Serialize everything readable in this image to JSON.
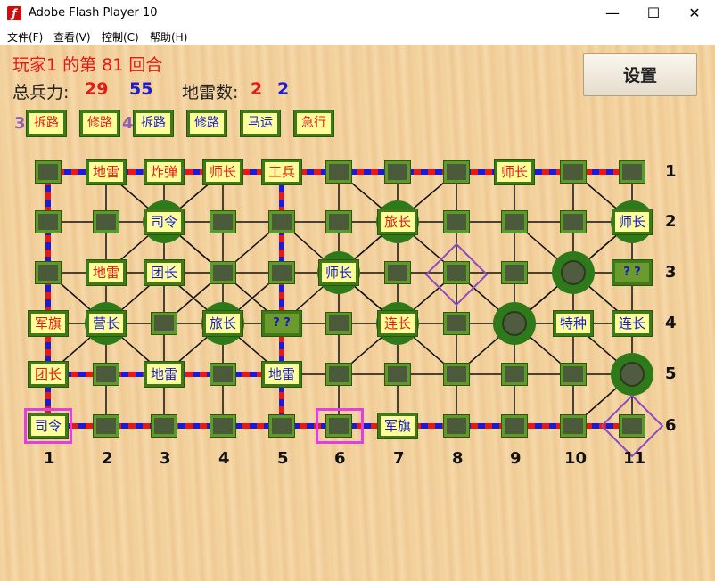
{
  "window": {
    "title": "Adobe Flash Player 10",
    "min": "—",
    "max": "☐",
    "close": "✕"
  },
  "menu": [
    "文件(F)",
    "查看(V)",
    "控制(C)",
    "帮助(H)"
  ],
  "status": {
    "turn_line": "玩家1  的第  81  回合",
    "troops_label": "总兵力:",
    "troops_red": "29",
    "troops_blue": "55",
    "mines_label": "地雷数:",
    "mines_red": "2",
    "mines_blue": "2"
  },
  "settings_button": "设置",
  "tools": {
    "red_count": "3",
    "blue_count": "4",
    "red_items": [
      "拆路",
      "修路"
    ],
    "blue_items": [
      "拆路",
      "修路",
      "马运",
      "急行"
    ]
  },
  "board": {
    "col_labels": [
      "1",
      "2",
      "3",
      "4",
      "5",
      "6",
      "7",
      "8",
      "9",
      "10",
      "11"
    ],
    "row_labels": [
      "1",
      "2",
      "3",
      "4",
      "5",
      "6"
    ],
    "red_color": "#e81818",
    "blue_color": "#1a1ad8",
    "unknown_text": "? ?",
    "pieces": [
      {
        "label": "地雷",
        "team": "red"
      },
      {
        "label": "炸弹",
        "team": "red"
      },
      {
        "label": "师长",
        "team": "red"
      },
      {
        "label": "工兵",
        "team": "red"
      },
      {
        "label": "师长",
        "team": "red"
      },
      {
        "label": "司令",
        "team": "blue"
      },
      {
        "label": "旅长",
        "team": "red"
      },
      {
        "label": "师长",
        "team": "blue"
      },
      {
        "label": "地雷",
        "team": "red"
      },
      {
        "label": "团长",
        "team": "blue"
      },
      {
        "label": "师长",
        "team": "blue"
      },
      {
        "label": "军旗",
        "team": "red"
      },
      {
        "label": "营长",
        "team": "blue"
      },
      {
        "label": "旅长",
        "team": "blue"
      },
      {
        "label": "连长",
        "team": "red"
      },
      {
        "label": "特种",
        "team": "blue"
      },
      {
        "label": "连长",
        "team": "blue"
      },
      {
        "label": "团长",
        "team": "red"
      },
      {
        "label": "地雷",
        "team": "blue"
      },
      {
        "label": "地雷",
        "team": "blue"
      },
      {
        "label": "司令",
        "team": "blue"
      },
      {
        "label": "军旗",
        "team": "blue"
      }
    ]
  }
}
